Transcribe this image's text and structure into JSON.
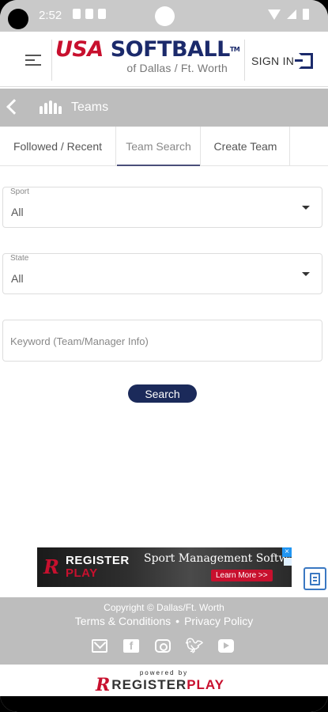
{
  "status_bar": {
    "time": "2:52"
  },
  "header": {
    "logo_part1": "USA",
    "logo_part2": "SOFTBALL",
    "logo_tm": "TM",
    "logo_subtitle": "of Dallas / Ft. Worth",
    "signin_label": "SIGN IN",
    "brand_colors": {
      "red": "#c8102e",
      "navy": "#1b2a6b"
    }
  },
  "breadcrumb": {
    "label": "Teams",
    "icon": "teams-icon"
  },
  "tabs": [
    {
      "label": "Followed / Recent",
      "active": false
    },
    {
      "label": "Team Search",
      "active": true
    },
    {
      "label": "Create Team",
      "active": false
    }
  ],
  "form": {
    "sport": {
      "label": "Sport",
      "value": "All"
    },
    "state": {
      "label": "State",
      "value": "All"
    },
    "keyword": {
      "placeholder": "Keyword (Team/Manager Info)",
      "value": ""
    },
    "search_label": "Search"
  },
  "ad": {
    "brand_line1": "REGISTER",
    "brand_line2": "PLAY",
    "headline": "Sport Management Software",
    "cta": "Learn More >>",
    "close": "×"
  },
  "footer": {
    "copyright": "Copyright © Dallas/Ft. Worth",
    "terms": "Terms & Conditions",
    "separator": "•",
    "privacy": "Privacy Policy",
    "social_icons": [
      "mail-icon",
      "facebook-icon",
      "instagram-icon",
      "twitter-icon",
      "youtube-icon"
    ]
  },
  "powered": {
    "powered_by": "powered by",
    "brand_register": "REGISTER",
    "brand_play": "PLAY"
  }
}
